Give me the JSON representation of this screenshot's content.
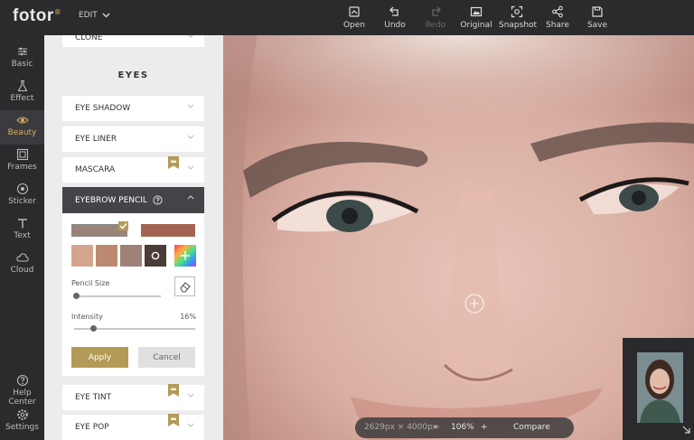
{
  "app": {
    "logo": "fotor",
    "edit_menu": "EDIT"
  },
  "toolbar": [
    {
      "key": "open",
      "label": "Open",
      "icon": "open-icon",
      "enabled": true
    },
    {
      "key": "undo",
      "label": "Undo",
      "icon": "undo-icon",
      "enabled": true
    },
    {
      "key": "redo",
      "label": "Redo",
      "icon": "redo-icon",
      "enabled": false
    },
    {
      "key": "original",
      "label": "Original",
      "icon": "original-icon",
      "enabled": true
    },
    {
      "key": "snapshot",
      "label": "Snapshot",
      "icon": "snapshot-icon",
      "enabled": true
    },
    {
      "key": "share",
      "label": "Share",
      "icon": "share-icon",
      "enabled": true
    },
    {
      "key": "save",
      "label": "Save",
      "icon": "save-icon",
      "enabled": true
    }
  ],
  "sidebar": {
    "items": [
      {
        "label": "Basic",
        "icon": "sliders-icon"
      },
      {
        "label": "Effect",
        "icon": "flask-icon"
      },
      {
        "label": "Beauty",
        "icon": "eye-icon",
        "active": true
      },
      {
        "label": "Frames",
        "icon": "frame-icon"
      },
      {
        "label": "Sticker",
        "icon": "sticker-icon"
      },
      {
        "label": "Text",
        "icon": "text-icon"
      },
      {
        "label": "Cloud",
        "icon": "cloud-icon"
      }
    ],
    "bottom": [
      {
        "label": "Help Center",
        "icon": "help-icon"
      },
      {
        "label": "Settings",
        "icon": "settings-icon"
      }
    ]
  },
  "panel": {
    "clone_label": "CLONE",
    "section_title": "EYES",
    "accordion": [
      {
        "label": "EYE SHADOW",
        "premium": false
      },
      {
        "label": "EYE LINER",
        "premium": false
      },
      {
        "label": "MASCARA",
        "premium": true
      }
    ],
    "open_item": {
      "label": "EYEBROW PENCIL",
      "help_icon": "question-icon"
    },
    "colors": {
      "top_selected": "#9b8377",
      "top_other": "#a46454",
      "row": [
        "#d4a48c",
        "#bd8a71",
        "#9e8177",
        "#4a3c36"
      ],
      "selected_color": "#9b8377"
    },
    "pencil_size_label": "Pencil Size",
    "intensity_label": "Intensity",
    "intensity_value": "16%",
    "pencil_size_value": 0.02,
    "intensity_fraction": 0.16,
    "apply_label": "Apply",
    "cancel_label": "Cancel",
    "lower_accordion": [
      {
        "label": "EYE TINT",
        "premium": true
      },
      {
        "label": "EYE POP",
        "premium": true
      }
    ]
  },
  "canvas": {
    "dimensions": "2629px × 4000px",
    "zoom": "106%",
    "compare_label": "Compare",
    "minus": "−",
    "plus": "+"
  },
  "colors": {
    "accent": "#b39a56",
    "active_nav": "#d6ad5a"
  }
}
